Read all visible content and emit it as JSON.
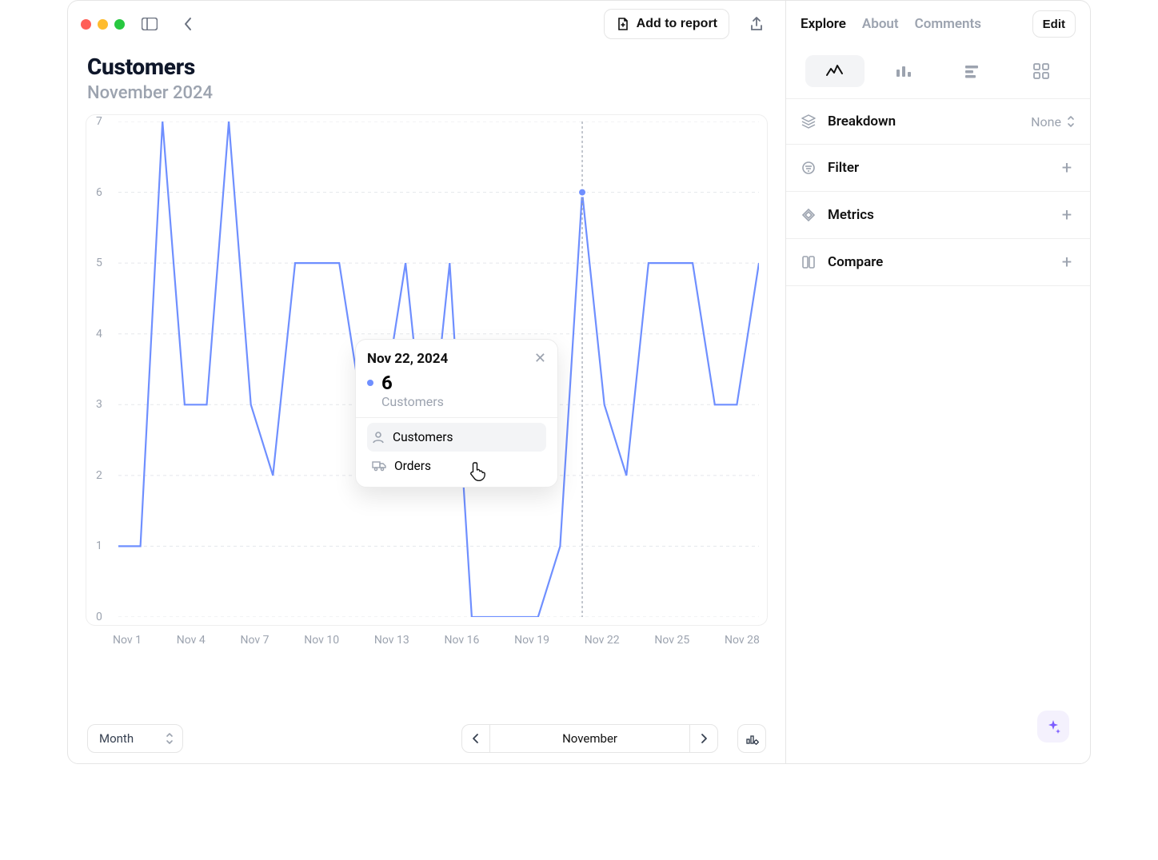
{
  "window": {
    "add_to_report": "Add to report"
  },
  "title": "Customers",
  "subtitle": "November 2024",
  "chart_data": {
    "type": "line",
    "xlabel": "",
    "ylabel": "",
    "ylim": [
      0,
      7
    ],
    "x_ticks": [
      "Nov 1",
      "Nov 4",
      "Nov 7",
      "Nov 10",
      "Nov 13",
      "Nov 16",
      "Nov 19",
      "Nov 22",
      "Nov 25",
      "Nov 28"
    ],
    "y_ticks": [
      0,
      1,
      2,
      3,
      4,
      5,
      6,
      7
    ],
    "x": [
      "Nov 1",
      "Nov 2",
      "Nov 3",
      "Nov 4",
      "Nov 5",
      "Nov 6",
      "Nov 7",
      "Nov 8",
      "Nov 9",
      "Nov 10",
      "Nov 11",
      "Nov 12",
      "Nov 13",
      "Nov 14",
      "Nov 15",
      "Nov 16",
      "Nov 17",
      "Nov 18",
      "Nov 19",
      "Nov 20",
      "Nov 21",
      "Nov 22",
      "Nov 23",
      "Nov 24",
      "Nov 25",
      "Nov 26",
      "Nov 27",
      "Nov 28",
      "Nov 29",
      "Nov 30"
    ],
    "series": [
      {
        "name": "Customers",
        "values": [
          1,
          1,
          7,
          3,
          3,
          7,
          3,
          2,
          5,
          5,
          5,
          3,
          3,
          5,
          2,
          5,
          0,
          0,
          0,
          0,
          1,
          6,
          3,
          2,
          5,
          5,
          5,
          3,
          3,
          5
        ]
      }
    ],
    "hover_index": 21
  },
  "tooltip": {
    "date": "Nov 22, 2024",
    "value": "6",
    "value_label": "Customers",
    "items": [
      {
        "label": "Customers",
        "icon": "user"
      },
      {
        "label": "Orders",
        "icon": "truck"
      }
    ]
  },
  "footer": {
    "granularity": "Month",
    "period": "November"
  },
  "sidebar": {
    "tabs": [
      "Explore",
      "About",
      "Comments"
    ],
    "edit": "Edit",
    "rows": {
      "breakdown": {
        "label": "Breakdown",
        "value": "None"
      },
      "filter": {
        "label": "Filter"
      },
      "metrics": {
        "label": "Metrics"
      },
      "compare": {
        "label": "Compare"
      }
    }
  }
}
